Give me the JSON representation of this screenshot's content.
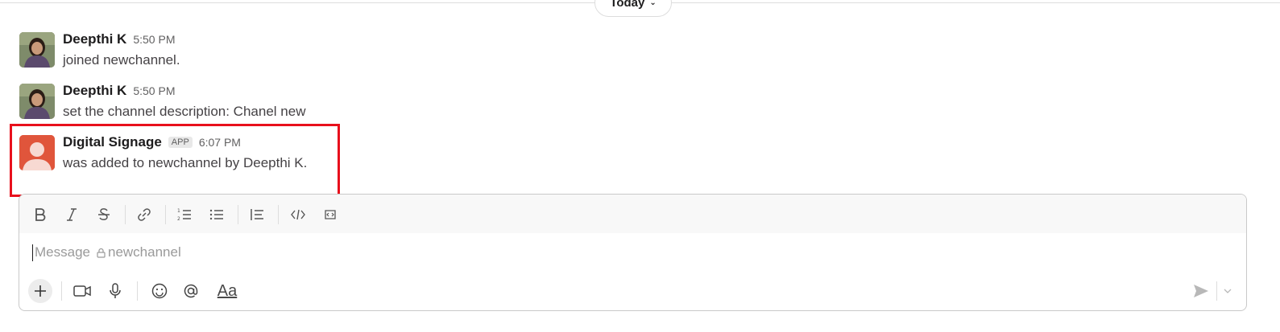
{
  "divider": {
    "label": "Today"
  },
  "messages": [
    {
      "author": "Deepthi K",
      "time": "5:50 PM",
      "text": "joined newchannel."
    },
    {
      "author": "Deepthi K",
      "time": "5:50 PM",
      "text": "set the channel description: Chanel new"
    },
    {
      "author": "Digital Signage",
      "badge": "APP",
      "time": "6:07 PM",
      "text": "was added to newchannel by Deepthi K."
    }
  ],
  "composer": {
    "placeholder_prefix": "Message",
    "channel": "newchannel",
    "toolbar_icons": [
      "bold-icon",
      "italic-icon",
      "strikethrough-icon",
      "link-icon",
      "ordered-list-icon",
      "bulleted-list-icon",
      "blockquote-icon",
      "code-icon",
      "code-block-icon"
    ],
    "bottom_icons": [
      "plus-icon",
      "video-icon",
      "microphone-icon",
      "emoji-icon",
      "mention-icon",
      "formatting-icon",
      "send-icon",
      "chevron-down-icon"
    ],
    "format_label": "Aa"
  },
  "colors": {
    "highlight": "#e8101c",
    "app_avatar": "#e0553b"
  }
}
